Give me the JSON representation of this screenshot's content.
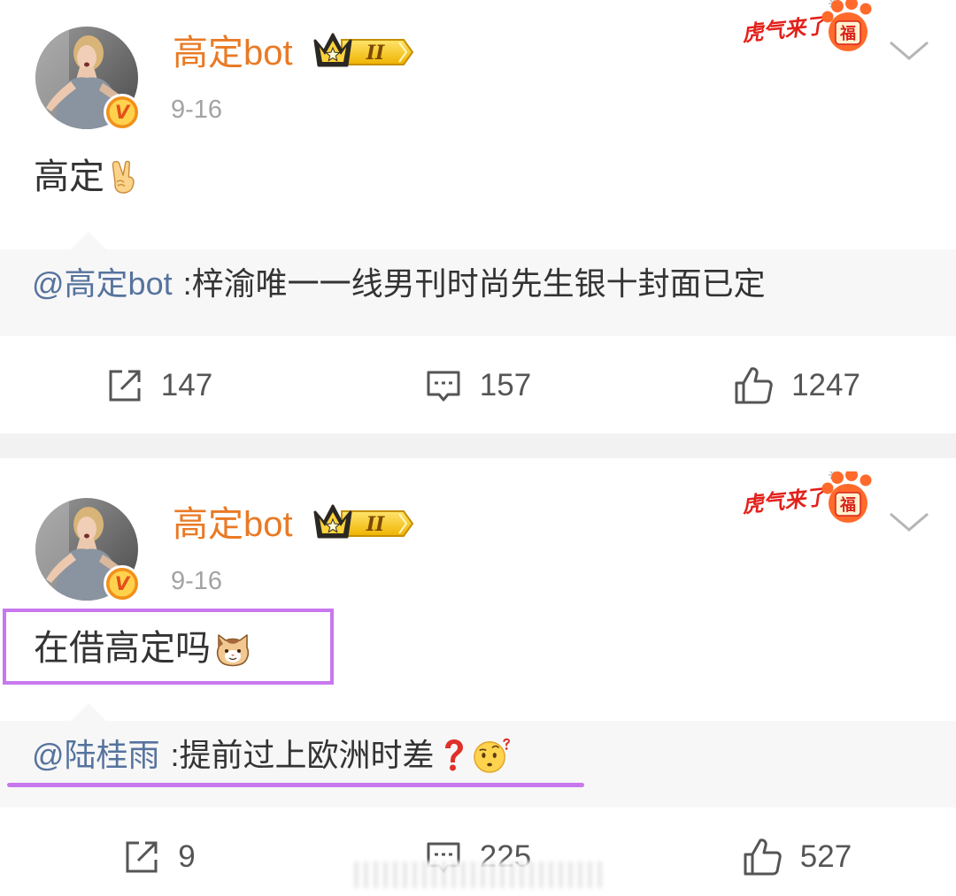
{
  "colors": {
    "username": "#e97a25",
    "mention": "#56739e",
    "annotation": "#c878ee",
    "text": "#333333",
    "date": "#a3a3a3",
    "repost_bg": "#f7f7f7",
    "separator": "#f2f2f2",
    "action": "#555555"
  },
  "posts": [
    {
      "avatar_icon": "avatar-photo",
      "verified_mark": "V",
      "username": "高定bot",
      "member_badge": "II",
      "member_badge_icon": "crown-icon",
      "date": "9-16",
      "sticker": {
        "text": "虎气来了",
        "seal": "福"
      },
      "menu_icon": "chevron-down-icon",
      "text": "高定",
      "text_emoji": [
        "victory-hand-icon"
      ],
      "repost": {
        "mention": "@高定bot",
        "text": ":梓渝唯一一线男刊时尚先生银十封面已定",
        "emoji": []
      },
      "actions": {
        "repost_icon": "share-icon",
        "repost_count": "147",
        "comment_icon": "comment-icon",
        "comment_count": "157",
        "like_icon": "thumbs-up-icon",
        "like_count": "1247"
      }
    },
    {
      "avatar_icon": "avatar-photo",
      "verified_mark": "V",
      "username": "高定bot",
      "member_badge": "II",
      "member_badge_icon": "crown-icon",
      "date": "9-16",
      "sticker": {
        "text": "虎气来了",
        "seal": "福"
      },
      "menu_icon": "chevron-down-icon",
      "text": "在借高定吗",
      "text_emoji": [
        "cat-face-icon"
      ],
      "highlighted": true,
      "repost": {
        "mention": "@陆桂雨",
        "text": ":提前过上欧洲时差",
        "emoji": [
          "red-question-mark-icon",
          "raised-eyebrow-face-icon"
        ],
        "underlined": true
      },
      "actions": {
        "repost_icon": "share-icon",
        "repost_count": "9",
        "comment_icon": "comment-icon",
        "comment_count": "225",
        "like_icon": "thumbs-up-icon",
        "like_count": "527"
      }
    }
  ]
}
